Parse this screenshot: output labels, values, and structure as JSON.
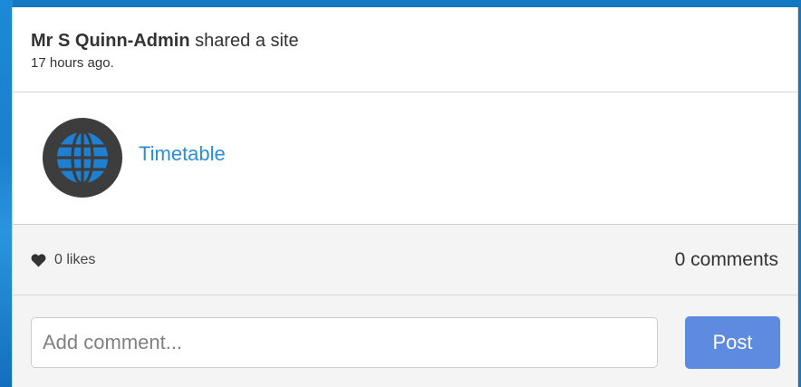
{
  "post": {
    "author": "Mr S Quinn-Admin",
    "action": " shared a site",
    "time": "17 hours ago."
  },
  "site": {
    "icon": "globe-icon",
    "name": "Timetable"
  },
  "stats": {
    "likes_icon": "heart-icon",
    "likes": "0 likes",
    "comments": "0 comments"
  },
  "comment_box": {
    "placeholder": "Add comment...",
    "post_label": "Post"
  },
  "colors": {
    "link": "#2a8fd6",
    "post_button": "#5e8be0",
    "globe_dark": "#3d3d3d",
    "globe_blue": "#1f7fd0",
    "background": "#1378c4"
  }
}
